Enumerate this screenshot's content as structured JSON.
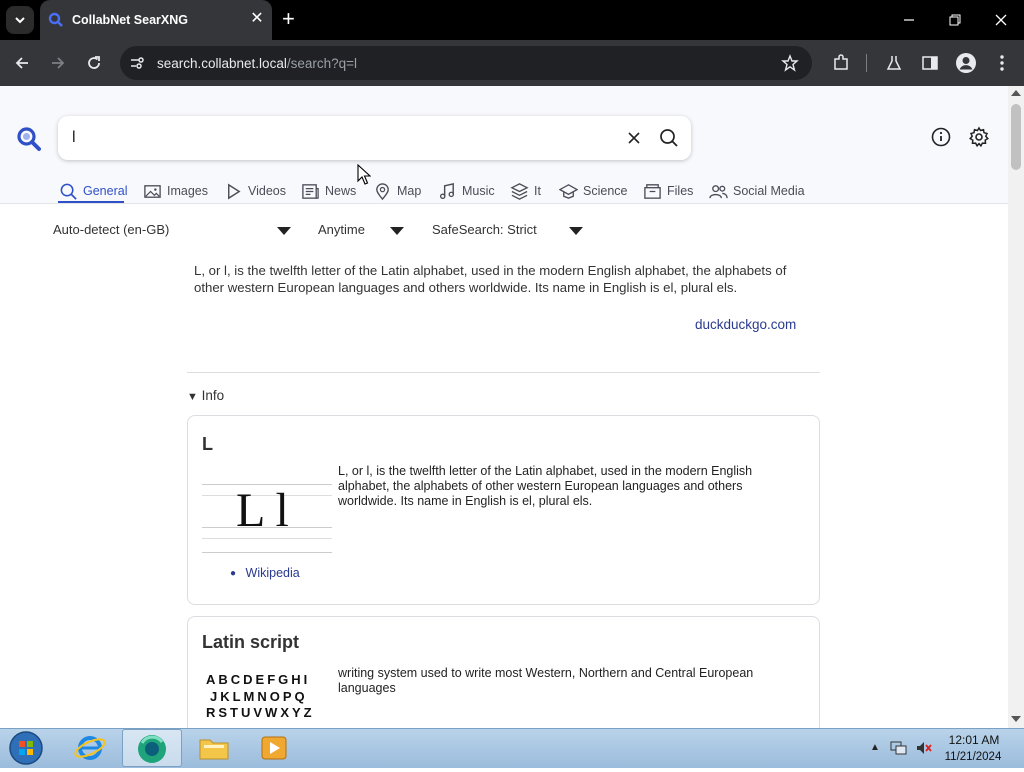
{
  "browser": {
    "tab_title": "CollabNet SearXNG",
    "url_host": "search.collabnet.local",
    "url_path": "/search?q=l"
  },
  "search": {
    "query": "l",
    "categories": [
      "General",
      "Images",
      "Videos",
      "News",
      "Map",
      "Music",
      "It",
      "Science",
      "Files",
      "Social Media"
    ],
    "active_category": "General"
  },
  "filters": {
    "language": "Auto-detect (en-GB)",
    "time": "Anytime",
    "safesearch": "SafeSearch: Strict"
  },
  "abstract": {
    "text": "L, or l, is the twelfth letter of the Latin alphabet, used in the modern English alphabet, the alphabets of other western European languages and others worldwide. Its name in English is el, plural els.",
    "source": "duckduckgo.com"
  },
  "info": {
    "toggle_label": "Info",
    "card1": {
      "title": "L",
      "image_text": "L l",
      "text": "L, or l, is the twelfth letter of the Latin alphabet, used in the modern English alphabet, the alphabets of other western European languages and others worldwide. Its name in English is el, plural els.",
      "link": "Wikipedia"
    },
    "card2": {
      "title": "Latin script",
      "image_lines": [
        "ABCDEFGHI",
        "JKLMNOPQ",
        "RSTUVWXYZ"
      ],
      "text": "writing system used to write most Western, Northern and Central European languages"
    }
  },
  "taskbar": {
    "time": "12:01 AM",
    "date": "11/21/2024"
  },
  "colors": {
    "accent": "#3050c8",
    "chrome_dark": "#35363a"
  }
}
